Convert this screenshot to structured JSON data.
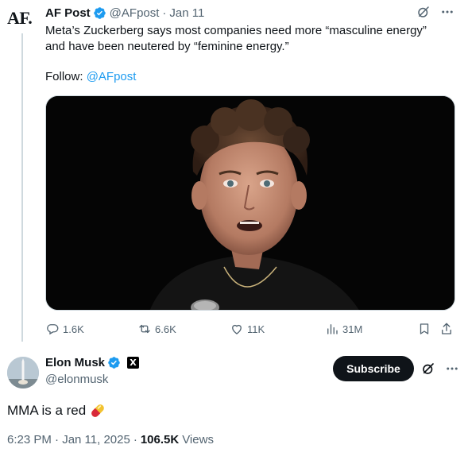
{
  "quoted_post": {
    "logo_text": "AF.",
    "display_name": "AF Post",
    "handle": "@AFpost",
    "separator": "·",
    "time": "Jan 11",
    "text_lines": [
      "Meta’s Zuckerberg says most companies need more “masculine energy”",
      "and have been neutered by “feminine energy.”"
    ],
    "follow_label": "Follow:",
    "follow_handle": "@AFpost",
    "actions": {
      "replies": "1.6K",
      "reposts": "6.6K",
      "likes": "11K",
      "views": "31M"
    }
  },
  "reply_post": {
    "display_name": "Elon Musk",
    "affiliate_badge": "X",
    "handle": "@elonmusk",
    "subscribe_label": "Subscribe",
    "text": "MMA is a red",
    "timestamp": "6:23 PM · Jan 11, 2025",
    "meta_separator": "·",
    "views_count": "106.5K",
    "views_label": "Views"
  },
  "colors": {
    "accent": "#1d9bf0",
    "text_primary": "#0f1419",
    "text_secondary": "#536471",
    "button_dark": "#0f1419"
  },
  "icons": [
    "verified-badge-icon",
    "grok-icon",
    "more-icon",
    "reply-icon",
    "repost-icon",
    "like-icon",
    "views-icon",
    "bookmark-icon",
    "share-icon",
    "pill-emoji-icon"
  ]
}
